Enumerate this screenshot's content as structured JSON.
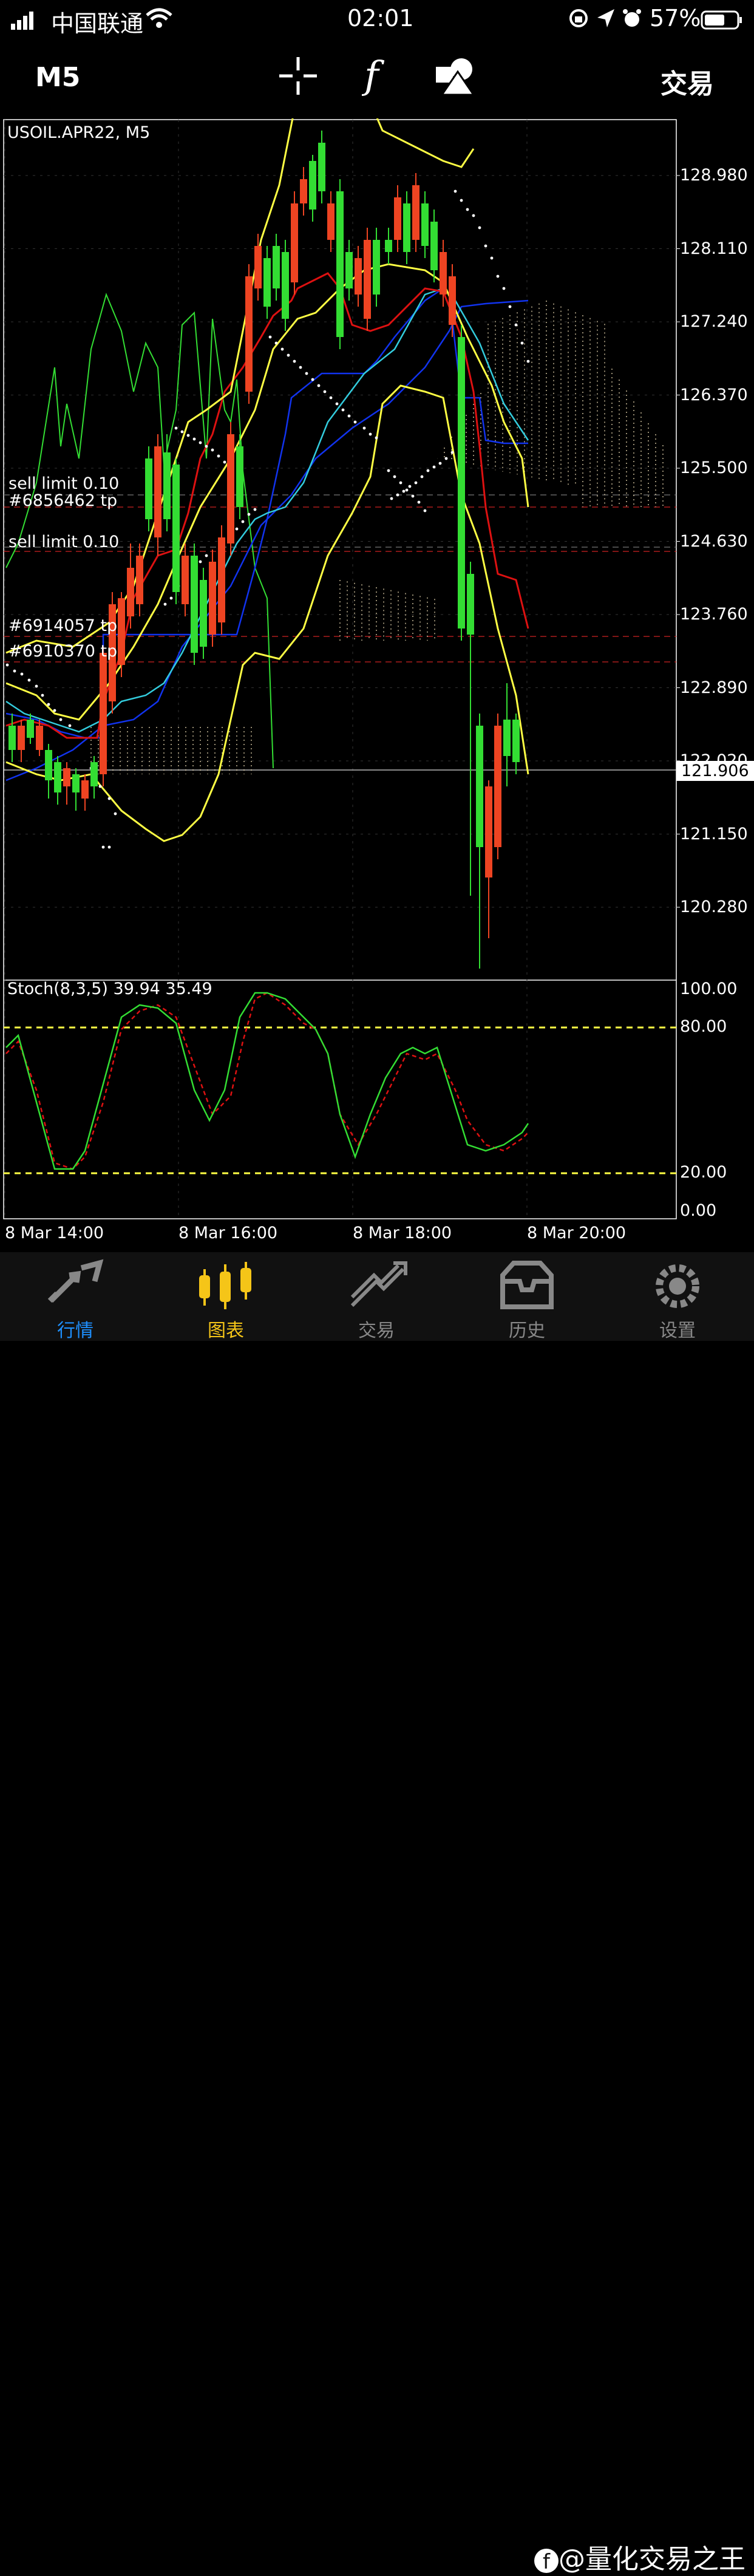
{
  "status_bar": {
    "carrier": "中国联通",
    "time": "02:01",
    "battery": "57%"
  },
  "toolbar": {
    "timeframe": "M5",
    "trade_label": "交易",
    "icons": [
      "crosshair-icon",
      "function-icon",
      "objects-icon"
    ]
  },
  "chart": {
    "symbol_label": "USOIL.APR22, M5",
    "current_price": "121.906",
    "price_ticks": [
      "128.980",
      "128.110",
      "127.240",
      "126.370",
      "125.500",
      "124.630",
      "123.760",
      "122.890",
      "122.020",
      "121.150",
      "120.280"
    ],
    "time_ticks": [
      "8 Mar 14:00",
      "8 Mar 16:00",
      "8 Mar 18:00",
      "8 Mar 20:00"
    ],
    "orders": [
      "sell limit 0.10",
      "#6856462 tp",
      "sell limit 0.10",
      "#6914057 tp",
      "#6910370 tp"
    ],
    "stoch_label": "Stoch(8,3,5) 39.94 35.49",
    "stoch_ticks": [
      "100.00",
      "80.00",
      "20.00",
      "0.00"
    ]
  },
  "tabs": [
    {
      "label": "行情",
      "icon": "quotes-icon",
      "active": false,
      "color": "#1e90ff"
    },
    {
      "label": "图表",
      "icon": "chart-icon",
      "active": true,
      "color": "#f5c518"
    },
    {
      "label": "交易",
      "icon": "trade-icon",
      "active": false
    },
    {
      "label": "历史",
      "icon": "history-icon",
      "active": false
    },
    {
      "label": "设置",
      "icon": "settings-icon",
      "active": false
    }
  ],
  "watermark": "@量化交易之王",
  "colors": {
    "bull": "#33dd33",
    "bear": "#ee4422",
    "ma_red": "#dd1111",
    "ma_blue": "#1133ee",
    "cyan": "#33ccdd",
    "yellow": "#ffff44",
    "green": "#33dd33"
  }
}
